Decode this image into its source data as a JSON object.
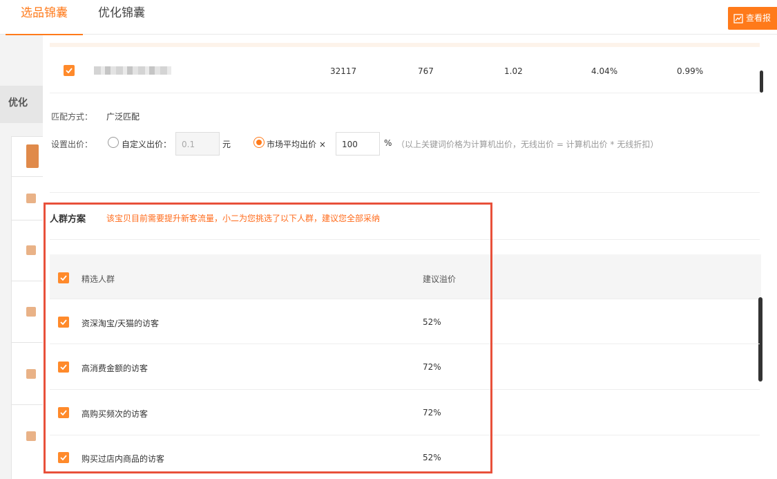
{
  "tabs": [
    {
      "label": "选品锦囊",
      "active": true
    },
    {
      "label": "优化锦囊",
      "active": false
    }
  ],
  "report_button": {
    "label": "查看报",
    "icon": "chart-trend-icon"
  },
  "background": {
    "title": "优化"
  },
  "keyword_row": {
    "checked": true,
    "cells": [
      "32117",
      "767",
      "1.02",
      "4.04%",
      "0.99%"
    ]
  },
  "match": {
    "label": "匹配方式：",
    "value": "广泛匹配"
  },
  "bid": {
    "label": "设置出价：",
    "custom_label": "自定义出价：",
    "custom_value": "0.1",
    "custom_unit": "元",
    "market_label": "市场平均出价 ×",
    "market_value": "100",
    "market_unit": "%",
    "note": "（以上关键词价格为计算机出价，无线出价 = 计算机出价 * 无线折扣）"
  },
  "crowd": {
    "title": "人群方案",
    "tip": "该宝贝目前需要提升新客流量，小二为您挑选了以下人群，建议您全部采纳",
    "header": {
      "name": "精选人群",
      "price": "建议溢价"
    },
    "rows": [
      {
        "name": "资深淘宝/天猫的访客",
        "price": "52%"
      },
      {
        "name": "高消费金额的访客",
        "price": "72%"
      },
      {
        "name": "高购买频次的访客",
        "price": "72%"
      },
      {
        "name": "购买过店内商品的访客",
        "price": "52%"
      }
    ]
  },
  "colors": {
    "accent": "#ff7a1a",
    "highlight_box": "#e8503a",
    "tip_text": "#ff6a1a"
  }
}
